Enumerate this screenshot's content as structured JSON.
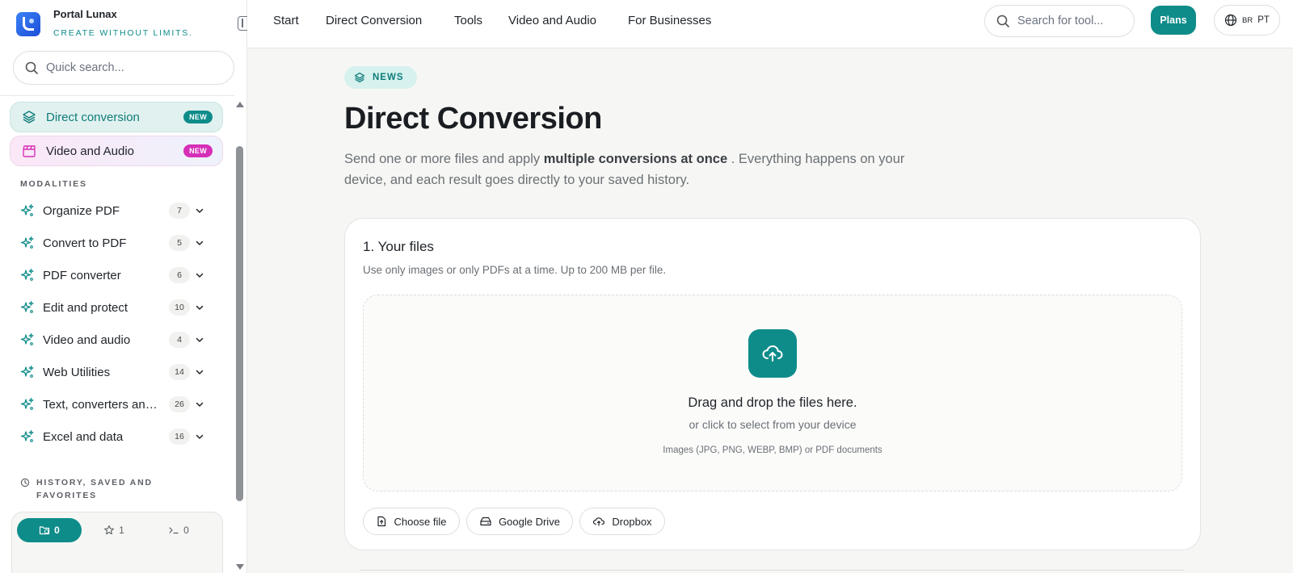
{
  "brand": {
    "name": "Portal Lunax",
    "tagline": "CREATE WITHOUT LIMITS."
  },
  "sidebar": {
    "search_placeholder": "Quick search...",
    "featured": [
      {
        "label": "Direct conversion",
        "badge": "NEW"
      },
      {
        "label": "Video and Audio",
        "badge": "NEW"
      }
    ],
    "modalities_title": "MODALITIES",
    "modalities": [
      {
        "label": "Organize PDF",
        "count": "7"
      },
      {
        "label": "Convert to PDF",
        "count": "5"
      },
      {
        "label": "PDF converter",
        "count": "6"
      },
      {
        "label": "Edit and protect",
        "count": "10"
      },
      {
        "label": "Video and audio",
        "count": "4"
      },
      {
        "label": "Web Utilities",
        "count": "14"
      },
      {
        "label": "Text, converters and more",
        "count": "26"
      },
      {
        "label": "Excel and data",
        "count": "16"
      }
    ],
    "history_title": "HISTORY, SAVED AND FAVORITES",
    "history_tabs": [
      {
        "label": "0",
        "icon": "folder-clock-icon",
        "active": true
      },
      {
        "label": "1",
        "icon": "star-icon",
        "active": false
      },
      {
        "label": "0",
        "icon": "terminal-icon",
        "active": false
      }
    ]
  },
  "header": {
    "nav": [
      "Start",
      "Direct Conversion",
      "Tools",
      "Video and Audio",
      "For Businesses"
    ],
    "search_placeholder": "Search for tool...",
    "plans_label": "Plans",
    "lang_region": "BR",
    "lang_code": "PT"
  },
  "main": {
    "pill": "NEWS",
    "title": "Direct Conversion",
    "desc_before": "Send one or more files and apply ",
    "desc_bold": "multiple conversions at once",
    "desc_after": " . Everything happens on your device, and each result goes directly to your saved history.",
    "card": {
      "title": "1. Your files",
      "subtitle": "Use only images or only PDFs at a time. Up to 200 MB per file.",
      "drop_main": "Drag and drop the files here.",
      "drop_sub": "or click to select from your device",
      "drop_note": "Images (JPG, PNG, WEBP, BMP) or PDF documents",
      "buttons": [
        "Choose file",
        "Google Drive",
        "Dropbox"
      ]
    }
  },
  "colors": {
    "accent": "#0e8c8a",
    "pink": "#d62fb7",
    "bg": "#f6f7f4"
  }
}
